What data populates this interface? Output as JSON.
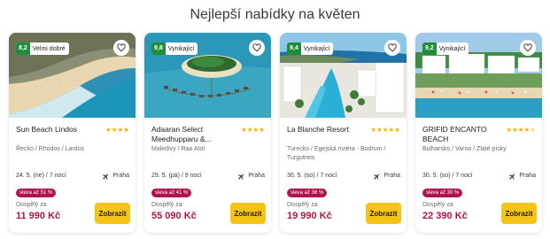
{
  "heading": "Nejlepší nabídky na květen",
  "colors": {
    "price": "#b0124e",
    "discount_bg": "#b0124e",
    "button_bg": "#f6c416",
    "rating_bg": "#1f8c3a",
    "star": "#f2b300"
  },
  "icons": {
    "favorite": "heart-icon",
    "departure": "plane-icon",
    "rating_star": "star-icon"
  },
  "offers": [
    {
      "rating_score": "8,2",
      "rating_label": "Velmi dobré",
      "name": "Sun Beach Lindos",
      "stars": 4,
      "location": "Řecko / Rhodos / Lardos",
      "date": "24. 5. (ne) / 7 nocí",
      "departure": "Praha",
      "discount": "sleva až 51 %",
      "price_label": "Dospělý za",
      "price": "11 990 Kč",
      "button": "Zobrazit"
    },
    {
      "rating_score": "9,8",
      "rating_label": "Vynikající",
      "name": "Adaaran Select Meedhupparu &...",
      "stars": 4,
      "location": "Maledivy / Raa Atol",
      "date": "29. 5. (pá) / 9 nocí",
      "departure": "Praha",
      "discount": "sleva až 41 %",
      "price_label": "Dospělý za",
      "price": "55 090 Kč",
      "button": "Zobrazit"
    },
    {
      "rating_score": "9,4",
      "rating_label": "Vynikající",
      "name": "La Blanche Resort",
      "stars": 5,
      "location": "Turecko / Egejská riviéra - Bodrum / Turgutreis",
      "date": "30. 5. (so) / 7 nocí",
      "departure": "Praha",
      "discount": "sleva až 36 %",
      "price_label": "Dospělý za",
      "price": "19 990 Kč",
      "button": "Zobrazit"
    },
    {
      "rating_score": "9,2",
      "rating_label": "Vynikající",
      "name": "GRIFID ENCANTO BEACH",
      "stars": 4.5,
      "location": "Bulharsko / Varna / Zlaté písky",
      "date": "30. 5. (so) / 7 nocí",
      "departure": "Praha",
      "discount": "sleva až 30 %",
      "price_label": "Dospělý za",
      "price": "22 390 Kč",
      "button": "Zobrazit"
    }
  ]
}
